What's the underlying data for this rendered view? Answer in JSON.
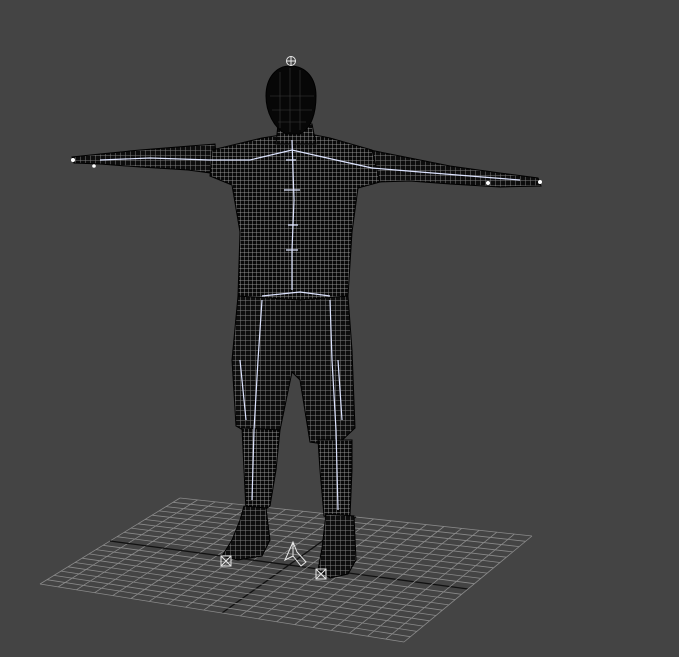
{
  "viewport": {
    "background_color": "#444444",
    "grid_color": "#8a8a8a",
    "axis_color": "#111111",
    "mesh_color": "#0b0b0b",
    "wire_color": "#b9b9b9",
    "bone_color": "#dde4ff",
    "helper_color": "#e8e8e8"
  },
  "scene": {
    "object": "character-mesh",
    "shading": "wireframe",
    "pose": "t-pose",
    "helpers": [
      "head-target-helper",
      "left-foot-helper",
      "right-foot-helper",
      "root-helper"
    ]
  }
}
